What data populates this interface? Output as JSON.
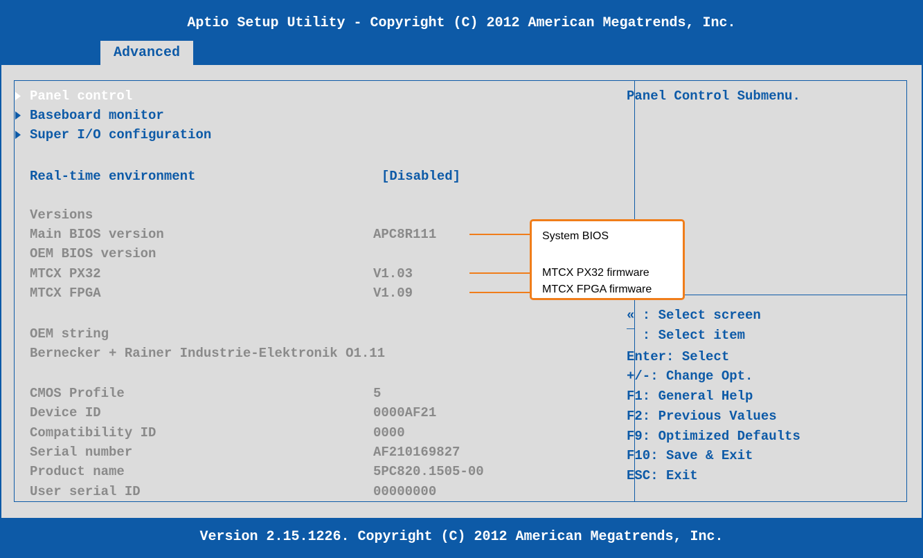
{
  "header": {
    "title": "Aptio Setup Utility - Copyright (C) 2012 American Megatrends, Inc.",
    "tab_label": "Advanced"
  },
  "menu": {
    "panel_control": "Panel control",
    "baseboard_monitor": "Baseboard monitor",
    "super_io": "Super I/O configuration",
    "realtime_label": "Real-time environment",
    "realtime_value": "[Disabled]"
  },
  "info": {
    "versions_heading": "Versions",
    "main_bios_label": "Main BIOS version",
    "main_bios_value": "APC8R111",
    "oem_bios_label": "OEM BIOS version",
    "mtcx_px32_label": "MTCX PX32",
    "mtcx_px32_value": "V1.03",
    "mtcx_fpga_label": "MTCX FPGA",
    "mtcx_fpga_value": "V1.09",
    "oem_string_label": "OEM string",
    "oem_string_value": "Bernecker + Rainer Industrie-Elektronik O1.11",
    "cmos_label": "CMOS Profile",
    "cmos_value": "5",
    "device_id_label": "Device ID",
    "device_id_value": "0000AF21",
    "compat_id_label": "Compatibility ID",
    "compat_id_value": "0000",
    "serial_label": "Serial number",
    "serial_value": "AF210169827",
    "product_label": "Product name",
    "product_value": "5PC820.1505-00",
    "user_serial_label": "User serial ID",
    "user_serial_value": "00000000"
  },
  "help": {
    "description": "Panel Control Submenu.",
    "keys": [
      "« : Select screen",
      "¯ : Select item",
      "Enter: Select",
      "+/-: Change Opt.",
      "F1: General Help",
      "F2: Previous Values",
      "F9: Optimized Defaults",
      "F10: Save & Exit",
      "ESC: Exit"
    ]
  },
  "callout": {
    "system_bios": "System BIOS",
    "px32_firmware": "MTCX PX32 firmware",
    "fpga_firmware": "MTCX FPGA firmware"
  },
  "footer": {
    "text": "Version 2.15.1226. Copyright (C) 2012 American Megatrends, Inc."
  },
  "colors": {
    "accent": "#0d5aa7",
    "background": "#dcdcdc",
    "callout": "#f07d1a"
  }
}
